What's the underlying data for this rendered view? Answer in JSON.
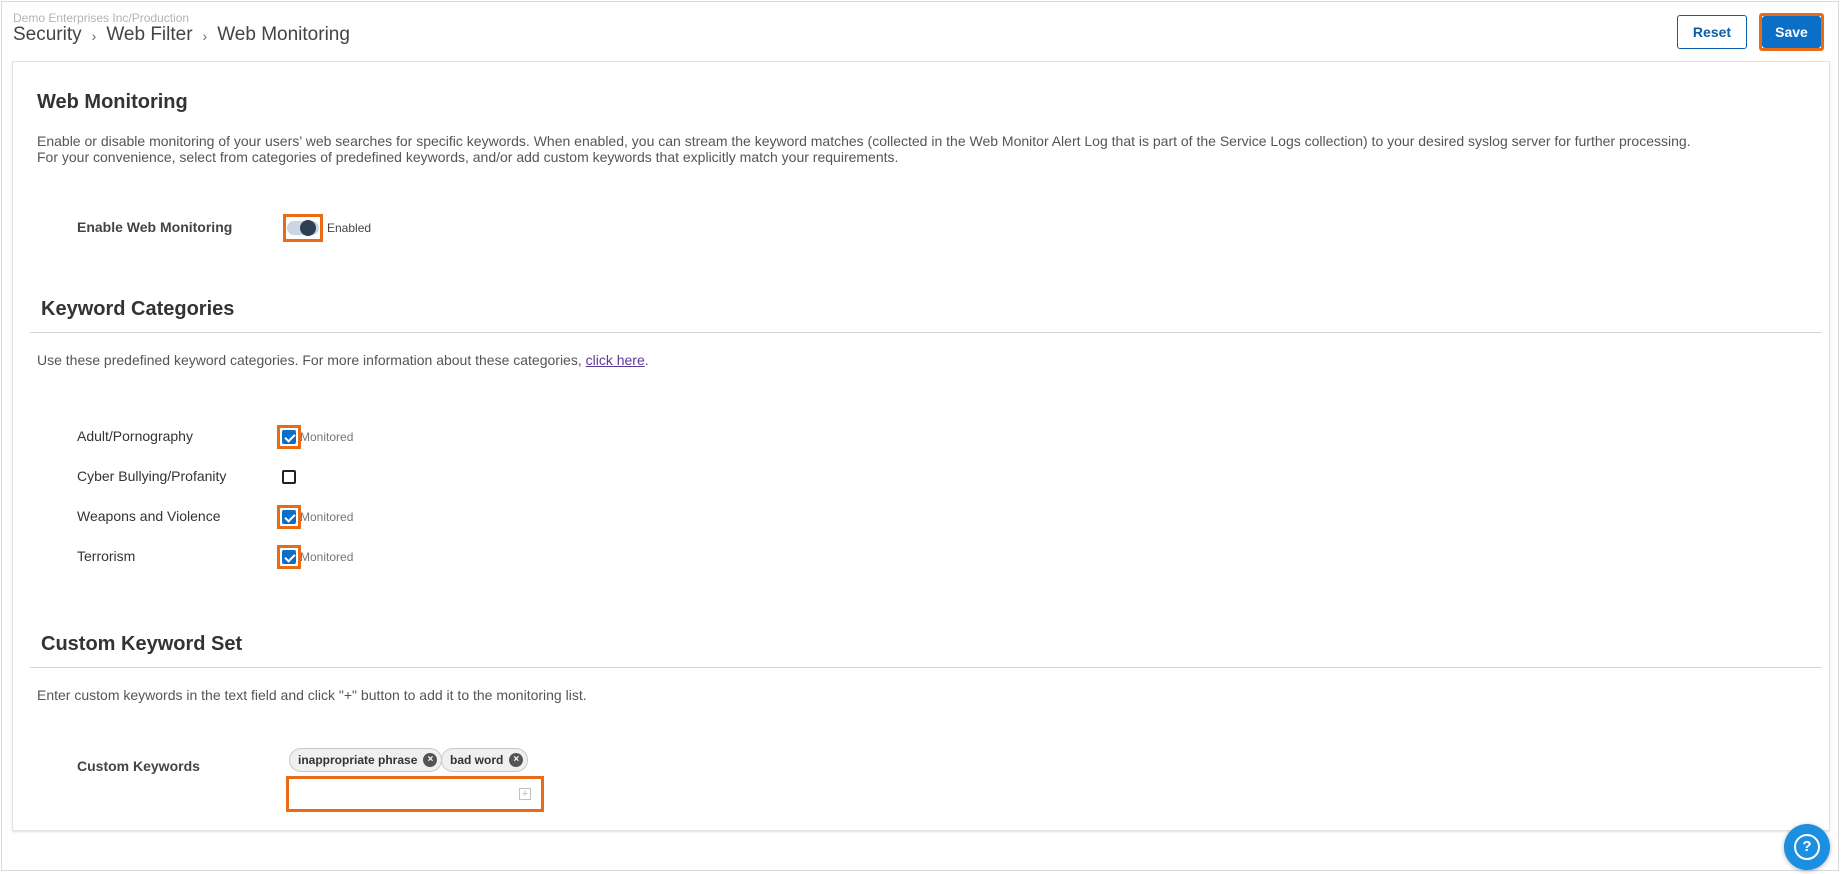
{
  "header": {
    "org": "Demo Enterprises Inc/Production",
    "breadcrumbs": [
      "Security",
      "Web Filter",
      "Web Monitoring"
    ],
    "reset_label": "Reset",
    "save_label": "Save"
  },
  "web_monitoring": {
    "title": "Web Monitoring",
    "description_line1": "Enable or disable monitoring of your users’ web searches for specific keywords. When enabled, you can stream the keyword matches (collected in the Web Monitor Alert Log that is part of the Service Logs collection) to your desired syslog server for further processing.",
    "description_line2": "For your convenience, select from categories of predefined keywords, and/or add custom keywords that explicitly match your requirements.",
    "enable_label": "Enable Web Monitoring",
    "enabled": true,
    "status_text": "Enabled"
  },
  "keyword_categories": {
    "title": "Keyword Categories",
    "description_prefix": "Use these predefined keyword categories. For more information about these categories, ",
    "link_text": "click here",
    "description_suffix": ".",
    "items": [
      {
        "label": "Adult/Pornography",
        "checked": true,
        "status": "Monitored"
      },
      {
        "label": "Cyber Bullying/Profanity",
        "checked": false,
        "status": ""
      },
      {
        "label": "Weapons and Violence",
        "checked": true,
        "status": "Monitored"
      },
      {
        "label": "Terrorism",
        "checked": true,
        "status": "Monitored"
      }
    ]
  },
  "custom_keywords": {
    "title": "Custom Keyword Set",
    "description": "Enter custom keywords in the text field and click \"+\" button to add it to the monitoring list.",
    "label": "Custom Keywords",
    "chips": [
      "inappropriate phrase",
      "bad word"
    ],
    "input_value": "",
    "input_placeholder": ""
  },
  "colors": {
    "primary": "#0b6fc7",
    "highlight": "#e96b16",
    "help": "#1b8fe0"
  }
}
